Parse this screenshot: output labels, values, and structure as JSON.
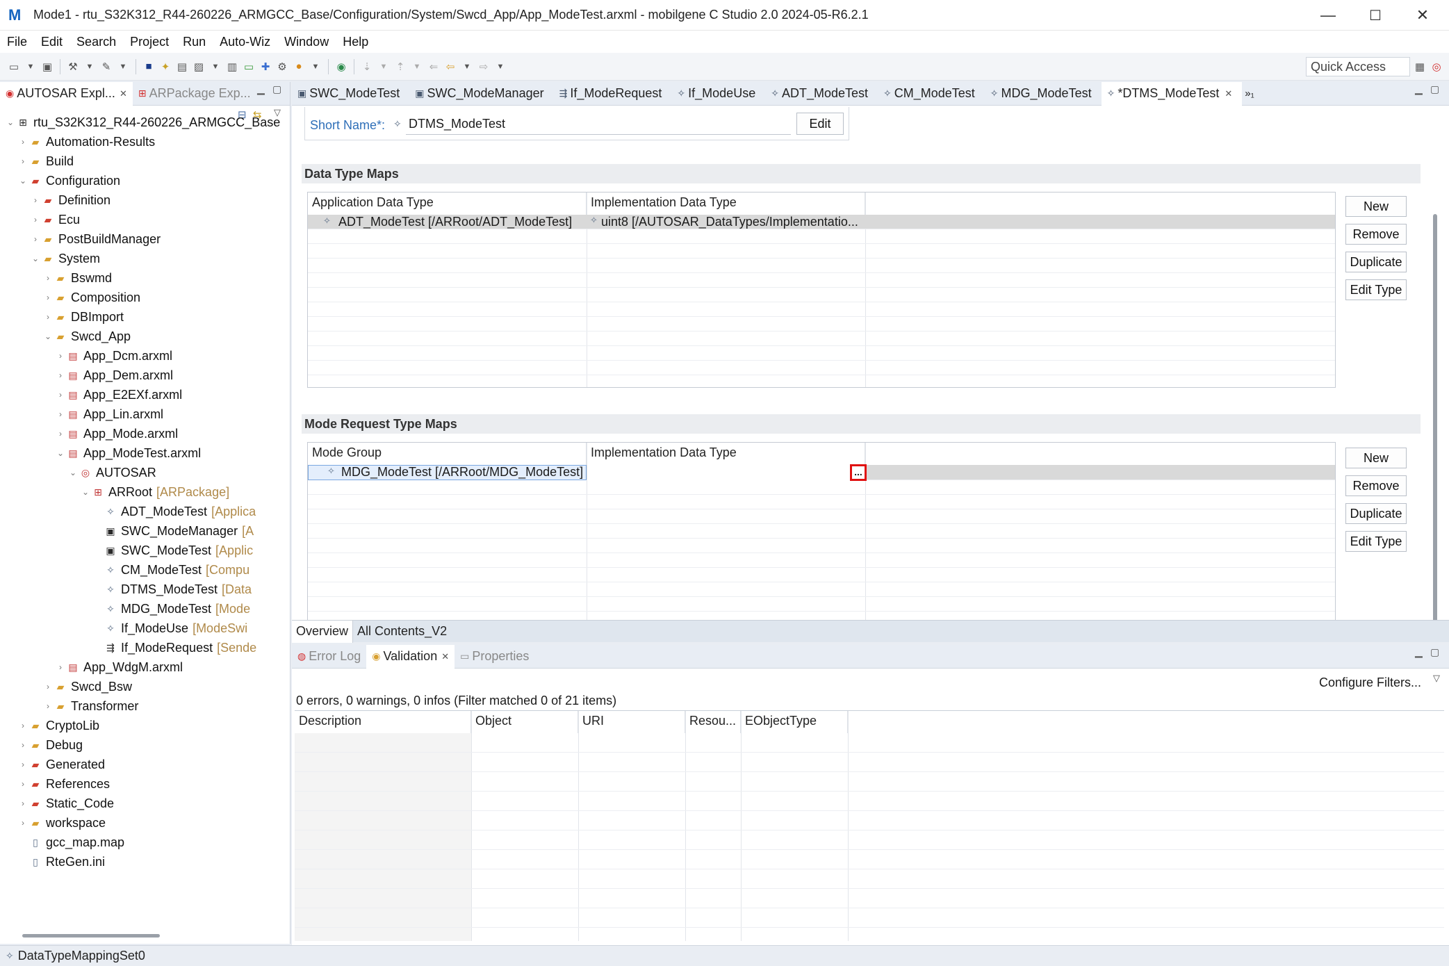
{
  "window": {
    "title": "Mode1 - rtu_S32K312_R44-260226_ARMGCC_Base/Configuration/System/Swcd_App/App_ModeTest.arxml - mobilgene C Studio 2.0 2024-05-R6.2.1",
    "minimize": "—",
    "maximize": "☐",
    "close": "✕"
  },
  "menu": [
    "File",
    "Edit",
    "Search",
    "Project",
    "Run",
    "Auto-Wiz",
    "Window",
    "Help"
  ],
  "toolbar": {
    "quick_access": "Quick Access"
  },
  "left_panel": {
    "tabs": [
      {
        "label": "AUTOSAR Expl...",
        "close": "✕"
      },
      {
        "label": "ARPackage Exp..."
      }
    ],
    "tree": [
      {
        "label": "rtu_S32K312_R44-260226_ARMGCC_Base",
        "meta": "",
        "level": 0,
        "arrow": "⌄",
        "icon": "project-icon"
      },
      {
        "label": "Automation-Results",
        "meta": "",
        "level": 1,
        "arrow": "›",
        "icon": "folder-icon"
      },
      {
        "label": "Build",
        "meta": "",
        "level": 1,
        "arrow": "›",
        "icon": "folder-icon"
      },
      {
        "label": "Configuration",
        "meta": "",
        "level": 1,
        "arrow": "⌄",
        "icon": "red-folder-icon"
      },
      {
        "label": "Definition",
        "meta": "",
        "level": 2,
        "arrow": "›",
        "icon": "red-folder-icon"
      },
      {
        "label": "Ecu",
        "meta": "",
        "level": 2,
        "arrow": "›",
        "icon": "red-folder-icon"
      },
      {
        "label": "PostBuildManager",
        "meta": "",
        "level": 2,
        "arrow": "›",
        "icon": "folder-icon"
      },
      {
        "label": "System",
        "meta": "",
        "level": 2,
        "arrow": "⌄",
        "icon": "folder-icon"
      },
      {
        "label": "Bswmd",
        "meta": "",
        "level": 3,
        "arrow": "›",
        "icon": "folder-icon"
      },
      {
        "label": "Composition",
        "meta": "",
        "level": 3,
        "arrow": "›",
        "icon": "folder-icon"
      },
      {
        "label": "DBImport",
        "meta": "",
        "level": 3,
        "arrow": "›",
        "icon": "folder-icon"
      },
      {
        "label": "Swcd_App",
        "meta": "",
        "level": 3,
        "arrow": "⌄",
        "icon": "folder-icon"
      },
      {
        "label": "App_Dcm.arxml",
        "meta": "",
        "level": 4,
        "arrow": "›",
        "icon": "file-icon"
      },
      {
        "label": "App_Dem.arxml",
        "meta": "",
        "level": 4,
        "arrow": "›",
        "icon": "file-icon"
      },
      {
        "label": "App_E2EXf.arxml",
        "meta": "",
        "level": 4,
        "arrow": "›",
        "icon": "file-icon"
      },
      {
        "label": "App_Lin.arxml",
        "meta": "",
        "level": 4,
        "arrow": "›",
        "icon": "file-icon"
      },
      {
        "label": "App_Mode.arxml",
        "meta": "",
        "level": 4,
        "arrow": "›",
        "icon": "file-icon"
      },
      {
        "label": "App_ModeTest.arxml",
        "meta": "",
        "level": 4,
        "arrow": "⌄",
        "icon": "file-icon"
      },
      {
        "label": "AUTOSAR",
        "meta": "",
        "level": 5,
        "arrow": "⌄",
        "icon": "autosar-icon"
      },
      {
        "label": "ARRoot",
        "meta": "[ARPackage]",
        "level": 6,
        "arrow": "⌄",
        "icon": "package-icon"
      },
      {
        "label": "ADT_ModeTest",
        "meta": "[Applica",
        "level": 7,
        "arrow": "",
        "icon": "star-icon"
      },
      {
        "label": "SWC_ModeManager",
        "meta": "[A",
        "level": 7,
        "arrow": "",
        "icon": "component-icon"
      },
      {
        "label": "SWC_ModeTest",
        "meta": "[Applic",
        "level": 7,
        "arrow": "",
        "icon": "component-icon"
      },
      {
        "label": "CM_ModeTest",
        "meta": "[Compu",
        "level": 7,
        "arrow": "",
        "icon": "star-icon"
      },
      {
        "label": "DTMS_ModeTest",
        "meta": "[Data",
        "level": 7,
        "arrow": "",
        "icon": "star-icon"
      },
      {
        "label": "MDG_ModeTest",
        "meta": "[Mode",
        "level": 7,
        "arrow": "",
        "icon": "star-icon"
      },
      {
        "label": "If_ModeUse",
        "meta": "[ModeSwi",
        "level": 7,
        "arrow": "",
        "icon": "star-icon"
      },
      {
        "label": "If_ModeRequest",
        "meta": "[Sende",
        "level": 7,
        "arrow": "",
        "icon": "interface-icon"
      },
      {
        "label": "App_WdgM.arxml",
        "meta": "",
        "level": 4,
        "arrow": "›",
        "icon": "file-icon"
      },
      {
        "label": "Swcd_Bsw",
        "meta": "",
        "level": 3,
        "arrow": "›",
        "icon": "folder-icon"
      },
      {
        "label": "Transformer",
        "meta": "",
        "level": 3,
        "arrow": "›",
        "icon": "folder-icon"
      },
      {
        "label": "CryptoLib",
        "meta": "",
        "level": 1,
        "arrow": "›",
        "icon": "folder-icon"
      },
      {
        "label": "Debug",
        "meta": "",
        "level": 1,
        "arrow": "›",
        "icon": "folder-icon"
      },
      {
        "label": "Generated",
        "meta": "",
        "level": 1,
        "arrow": "›",
        "icon": "red-folder-icon"
      },
      {
        "label": "References",
        "meta": "",
        "level": 1,
        "arrow": "›",
        "icon": "red-folder-icon"
      },
      {
        "label": "Static_Code",
        "meta": "",
        "level": 1,
        "arrow": "›",
        "icon": "red-folder-icon"
      },
      {
        "label": "workspace",
        "meta": "",
        "level": 1,
        "arrow": "›",
        "icon": "folder-icon"
      },
      {
        "label": "gcc_map.map",
        "meta": "",
        "level": 1,
        "arrow": "",
        "icon": "text-file-icon"
      },
      {
        "label": "RteGen.ini",
        "meta": "",
        "level": 1,
        "arrow": "",
        "icon": "text-file-icon"
      }
    ]
  },
  "editor": {
    "tabs": [
      {
        "label": "SWC_ModeTest",
        "icon": "component-icon",
        "active": false
      },
      {
        "label": "SWC_ModeManager",
        "icon": "component-icon",
        "active": false
      },
      {
        "label": "If_ModeRequest",
        "icon": "interface-icon",
        "active": false
      },
      {
        "label": "If_ModeUse",
        "icon": "star-icon",
        "active": false
      },
      {
        "label": "ADT_ModeTest",
        "icon": "star-icon",
        "active": false
      },
      {
        "label": "CM_ModeTest",
        "icon": "star-icon",
        "active": false
      },
      {
        "label": "MDG_ModeTest",
        "icon": "star-icon",
        "active": false
      },
      {
        "label": "*DTMS_ModeTest",
        "icon": "star-icon",
        "active": true
      }
    ],
    "overflow": "»₁",
    "short_name_label": "Short Name*:",
    "short_name_value": "DTMS_ModeTest",
    "edit_button": "Edit",
    "data_type_maps": {
      "title": "Data Type Maps",
      "columns": [
        "Application Data Type",
        "Implementation Data Type"
      ],
      "rows": [
        {
          "app": "ADT_ModeTest [/ARRoot/ADT_ModeTest]",
          "impl": "uint8 [/AUTOSAR_DataTypes/Implementatio..."
        }
      ],
      "buttons": [
        "New",
        "Remove",
        "Duplicate",
        "Edit Type"
      ]
    },
    "mode_request_type_maps": {
      "title": "Mode Request Type Maps",
      "columns": [
        "Mode Group",
        "Implementation Data Type"
      ],
      "rows": [
        {
          "mode_group": "MDG_ModeTest [/ARRoot/MDG_ModeTest]",
          "impl": "",
          "browse": "..."
        }
      ],
      "buttons": [
        "New",
        "Remove",
        "Duplicate",
        "Edit Type"
      ]
    },
    "bottom_tabs": [
      "Overview",
      "All Contents_V2"
    ]
  },
  "validation": {
    "tabs": [
      {
        "label": "Error Log",
        "active": false
      },
      {
        "label": "Validation",
        "active": true
      },
      {
        "label": "Properties",
        "active": false
      }
    ],
    "configure_filters": "Configure Filters...",
    "summary": "0 errors, 0 warnings, 0 infos (Filter matched 0 of 21 items)",
    "columns": [
      "Description",
      "Object",
      "URI",
      "Resou...",
      "EObjectType"
    ]
  },
  "status": {
    "text": "DataTypeMappingSet0"
  }
}
